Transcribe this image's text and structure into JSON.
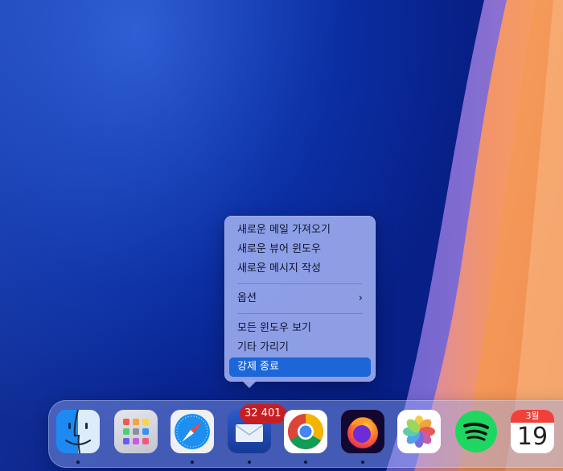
{
  "context_menu": {
    "items": [
      {
        "label": "새로운 메일 가져오기"
      },
      {
        "label": "새로운 뷰어 윈도우"
      },
      {
        "label": "새로운 메시지 작성"
      },
      {
        "label": "옵션",
        "submenu_chevron": "›"
      },
      {
        "label": "모든 윈도우 보기"
      },
      {
        "label": "기타 가리기"
      },
      {
        "label": "강제 종료",
        "selected": true
      }
    ]
  },
  "dock": {
    "apps": [
      {
        "name": "Finder",
        "icon": "finder-icon",
        "running": true
      },
      {
        "name": "Launchpad",
        "icon": "launchpad-icon",
        "running": false
      },
      {
        "name": "Safari",
        "icon": "safari-icon",
        "running": true
      },
      {
        "name": "Mail",
        "icon": "mail-icon",
        "running": true,
        "badge": "32 401"
      },
      {
        "name": "Google Chrome",
        "icon": "chrome-icon",
        "running": true
      },
      {
        "name": "Firefox",
        "icon": "firefox-icon",
        "running": true
      },
      {
        "name": "Photos",
        "icon": "photos-icon",
        "running": false
      },
      {
        "name": "Spotify",
        "icon": "spotify-icon",
        "running": false
      },
      {
        "name": "Calendar",
        "icon": "calendar-icon",
        "running": false,
        "month": "3월",
        "day": "19"
      }
    ]
  },
  "colors": {
    "wallpaper_blue": "#0b2ea3",
    "wallpaper_orange": "#f59a5c",
    "menu_selected": "#1c66d8",
    "badge_red": "#c51f24"
  }
}
